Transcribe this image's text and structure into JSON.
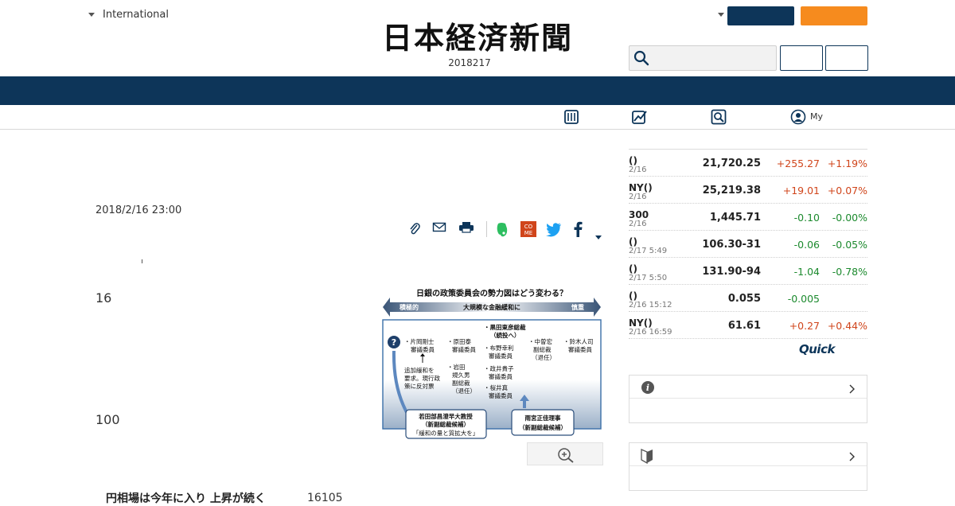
{
  "header": {
    "region_label": "International",
    "logo_text": "日本経済新聞",
    "edition_date": "2018217"
  },
  "subnav": {
    "my_label": "My"
  },
  "article": {
    "timestamp": "2018/2/16 23:00",
    "para_marker_1": "16",
    "para_marker_2": "100",
    "cut_caption": "円相場は今年に入り 上昇が続く",
    "cut_number": "16105",
    "figure": {
      "title": "日銀の政策委員会の勢力図はどう変わる？",
      "arrow_left": "積極的",
      "arrow_center": "大規模な金融緩和に",
      "arrow_right": "慎重",
      "question_mark": "?",
      "members": [
        {
          "l1": "・片岡剛士",
          "l2": "審議委員"
        },
        {
          "l1": "・原田泰",
          "l2": "審議委員"
        },
        {
          "l1": "・黒田東彦総裁",
          "l2": "（続投へ）"
        },
        {
          "l1": "・布野幸利",
          "l2": "審議委員"
        },
        {
          "l1": "・中曽宏",
          "l2": "副総裁"
        },
        {
          "l1": "・鈴木人司",
          "l2": "審議委員"
        },
        {
          "l1": "・岩田",
          "l2": "規久男"
        },
        {
          "l1": "・政井貴子",
          "l2": "審議委員"
        },
        {
          "l1": "・桜井真",
          "l2": "審議委員"
        }
      ],
      "extra_lines": [
        "（退任）",
        "副総裁",
        "（退任）"
      ],
      "note": [
        "追加緩和を",
        "要求。現行政",
        "策に反対票"
      ],
      "candidate1": [
        "若田部昌澄早大教授",
        "（新副総裁候補）",
        "「緩和の量と質拡大を」"
      ],
      "candidate2": [
        "雨宮正佳理事",
        "（新副総裁候補）"
      ]
    }
  },
  "markets": {
    "rows": [
      {
        "name": "()",
        "time": "2/16",
        "value": "21,720.25",
        "change": "+255.27",
        "pct": "+1.19%",
        "dir": "up"
      },
      {
        "name": "NY()",
        "time": "2/16",
        "value": "25,219.38",
        "change": "+19.01",
        "pct": "+0.07%",
        "dir": "up"
      },
      {
        "name": "300",
        "time": "2/16",
        "value": "1,445.71",
        "change": "-0.10",
        "pct": "-0.00%",
        "dir": "down"
      },
      {
        "name": "()",
        "time": "2/17 5:49",
        "value": "106.30-31",
        "change": "-0.06",
        "pct": "-0.05%",
        "dir": "down"
      },
      {
        "name": "()",
        "time": "2/17 5:50",
        "value": "131.90-94",
        "change": "-1.04",
        "pct": "-0.78%",
        "dir": "down"
      },
      {
        "name": "()",
        "time": "2/16 15:12",
        "value": "0.055",
        "change": "-0.005",
        "pct": "",
        "dir": "down"
      },
      {
        "name": "NY()",
        "time": "2/16 16:59",
        "value": "61.61",
        "change": "+0.27",
        "pct": "+0.44%",
        "dir": "up"
      }
    ],
    "provider_logo": "Quick"
  },
  "colors": {
    "navy": "#0d3559",
    "orange": "#f68b1e",
    "up": "#d0451b",
    "down": "#1c8a2e"
  },
  "icons": {
    "search": "search-icon",
    "tools": [
      "newspaper-icon",
      "chart-icon",
      "magnifier-icon",
      "user-icon"
    ],
    "share": [
      "clip-icon",
      "mail-icon",
      "print-icon",
      "evernote-icon",
      "comment-icon",
      "twitter-icon",
      "facebook-icon",
      "more-icon"
    ],
    "side": [
      "info-icon",
      "beginner-mark-icon"
    ]
  }
}
